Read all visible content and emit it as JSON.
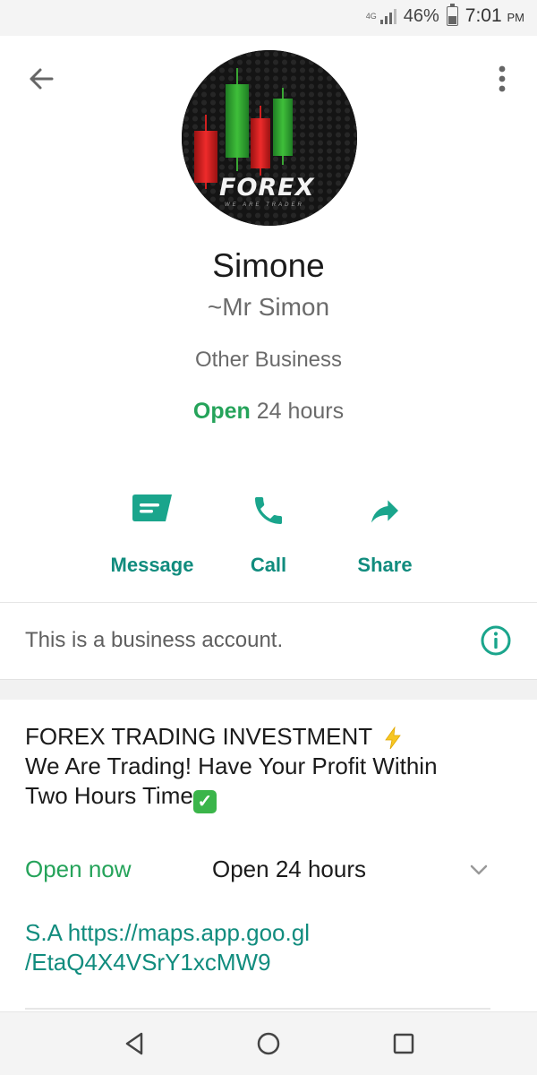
{
  "status_bar": {
    "network": "4G",
    "battery_percent": "46%",
    "battery_level": 0.46,
    "time": "7:01",
    "ampm": "PM"
  },
  "header": {
    "back_icon": "arrow-left-icon",
    "menu_icon": "more-vertical-icon"
  },
  "profile": {
    "avatar_logo": "FOREX",
    "avatar_tagline": "WE ARE TRADER",
    "name": "Simone",
    "subname": "~Mr Simon",
    "category": "Other Business",
    "hours_status": "Open",
    "hours_text": "24 hours"
  },
  "actions": [
    {
      "label": "Message",
      "icon": "message-icon"
    },
    {
      "label": "Call",
      "icon": "phone-icon"
    },
    {
      "label": "Share",
      "icon": "share-icon"
    }
  ],
  "business_notice": {
    "text": "This is a business account.",
    "icon": "info-icon"
  },
  "description": {
    "line1": "FOREX TRADING INVESTMENT",
    "line1_emoji": "lightning-icon",
    "line2": "We Are Trading! Have Your Profit Within",
    "line3": "Two Hours Time",
    "line3_emoji": "check-mark-icon"
  },
  "hours_row": {
    "status": "Open now",
    "text": "Open 24 hours",
    "icon": "chevron-down-icon"
  },
  "address": {
    "line1": "S.A https://maps.app.goo.gl",
    "line2": "/EtaQ4X4VSrY1xcMW9"
  },
  "colors": {
    "accent": "#118c7e",
    "open_green": "#25a35a"
  }
}
